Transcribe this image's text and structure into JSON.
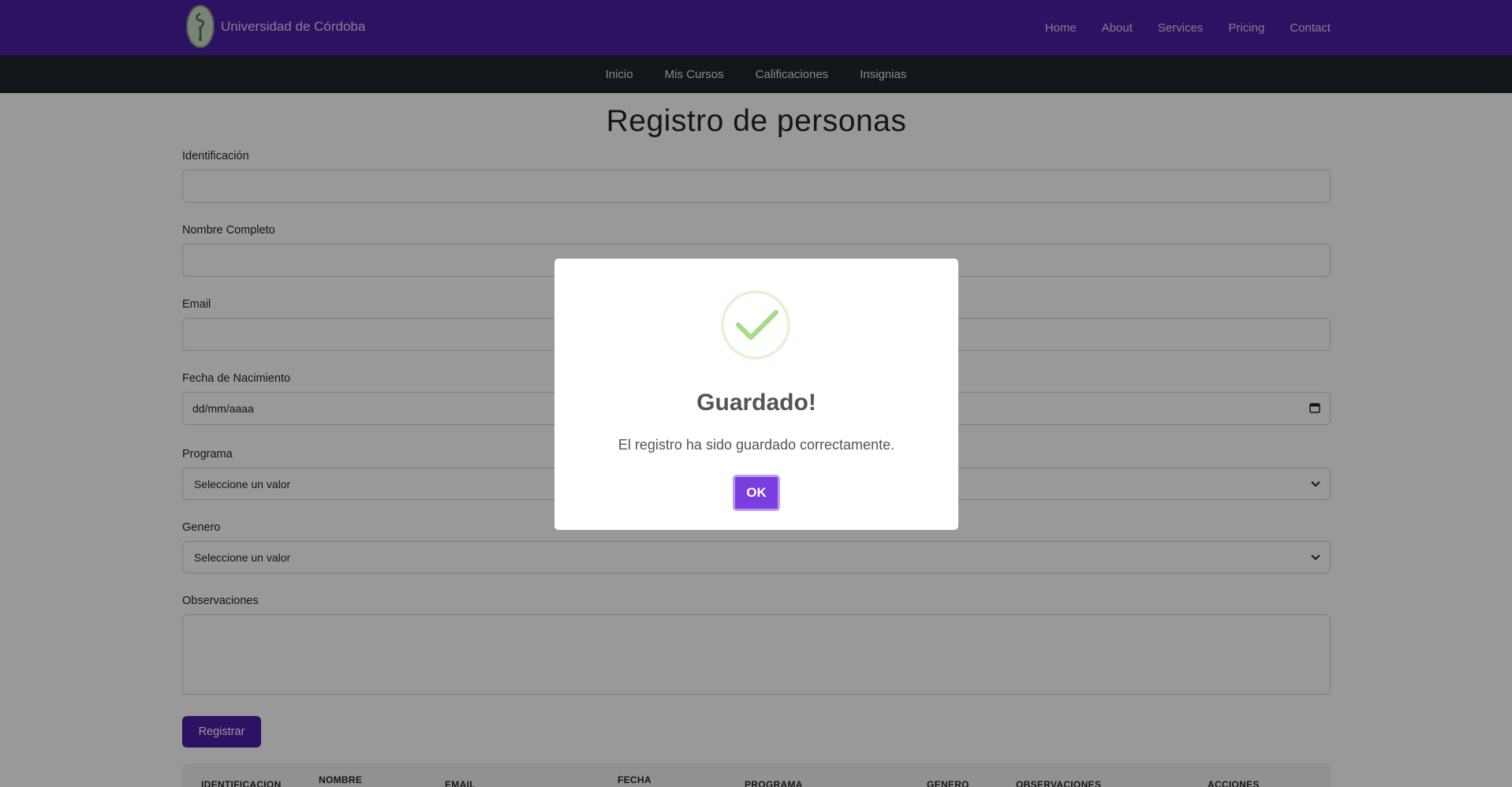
{
  "topbar": {
    "brand": "Universidad de Córdoba",
    "nav": [
      "Home",
      "About",
      "Services",
      "Pricing",
      "Contact"
    ]
  },
  "subnav": [
    "Inicio",
    "Mis Cursos",
    "Calificaciones",
    "Insignias"
  ],
  "form": {
    "title": "Registro de personas",
    "identificacion_label": "Identificación",
    "nombre_label": "Nombre Completo",
    "email_label": "Email",
    "fecha_label": "Fecha de Nacimiento",
    "fecha_placeholder": "dd/mm/aaaa",
    "programa_label": "Programa",
    "programa_value": "Seleccione un valor",
    "genero_label": "Genero",
    "genero_value": "Seleccione un valor",
    "observaciones_label": "Observaciones",
    "submit_label": "Registrar"
  },
  "table": {
    "headers": [
      "IDENTIFICACION",
      "NOMBRE",
      "EMAIL",
      "FECHA",
      "PROGRAMA",
      "GENERO",
      "OBSERVACIONES",
      "ACCIONES"
    ]
  },
  "modal": {
    "icon": "success-check-icon",
    "title": "Guardado!",
    "text": "El registro ha sido guardado correctamente.",
    "ok_label": "OK",
    "ok_color": "#7a3ee0"
  },
  "colors": {
    "topbar": "#4b1fa6",
    "subnav": "#212529",
    "primary_button": "#4b1fa6",
    "success_check": "#a5dc86"
  }
}
